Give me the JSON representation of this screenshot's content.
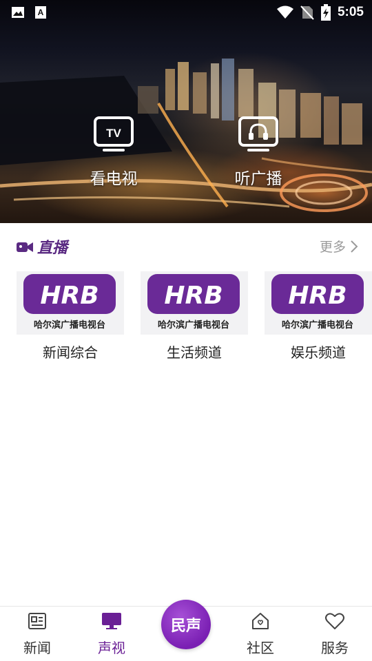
{
  "status_bar": {
    "time": "5:05",
    "icons": [
      "image-icon",
      "a-badge-icon",
      "wifi-icon",
      "no-sim-icon",
      "battery-charging-icon"
    ]
  },
  "hero": {
    "buttons": [
      {
        "label": "看电视",
        "icon": "tv-icon",
        "icon_text": "TV"
      },
      {
        "label": "听广播",
        "icon": "radio-headphones-icon"
      }
    ]
  },
  "live": {
    "title": "直播",
    "more": "更多",
    "accent_color": "#5a2a82",
    "channels": [
      {
        "name": "新闻综合",
        "logo_text": "HRB",
        "logo_subtitle": "哈尔滨广播电视台"
      },
      {
        "name": "生活频道",
        "logo_text": "HRB",
        "logo_subtitle": "哈尔滨广播电视台"
      },
      {
        "name": "娱乐频道",
        "logo_text": "HRB",
        "logo_subtitle": "哈尔滨广播电视台"
      }
    ]
  },
  "bottom_nav": {
    "active_color": "#6a1f95",
    "items": [
      {
        "label": "新闻",
        "icon": "news-icon"
      },
      {
        "label": "声视",
        "icon": "monitor-icon",
        "active": true
      },
      {
        "label": "民声",
        "icon": "center-badge"
      },
      {
        "label": "社区",
        "icon": "home-icon"
      },
      {
        "label": "服务",
        "icon": "heart-icon"
      }
    ]
  }
}
